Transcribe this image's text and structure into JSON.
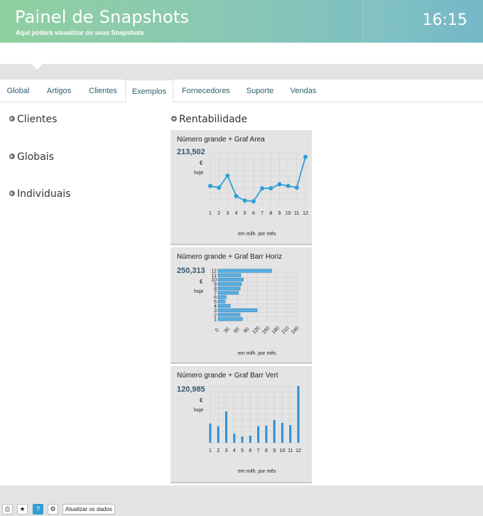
{
  "header": {
    "title": "Painel de Snapshots",
    "subtitle": "Aqui poderá visualizar os seus Snapshots",
    "time": "16:15"
  },
  "tabs": [
    "Global",
    "Artigos",
    "Clientes",
    "Exemplos",
    "Fornecedores",
    "Suporte",
    "Vendas"
  ],
  "active_tab": "Exemplos",
  "sections": [
    "Clientes",
    "Globais",
    "Individuais"
  ],
  "rentabilidade": "Rentabilidade",
  "cards": [
    {
      "title": "Número grande + Graf Area",
      "value": "213,502",
      "currency": "€",
      "period": "hoje",
      "units": "em milh. por mês"
    },
    {
      "title": "Número grande + Graf Barr Horiz",
      "value": "250,313",
      "currency": "€",
      "period": "hoje",
      "units": "em milh. por mês"
    },
    {
      "title": "Número grande + Graf Barr Vert",
      "value": "120,985",
      "currency": "€",
      "period": "hoje",
      "units": "em milh. por mês"
    }
  ],
  "footer": {
    "refresh_label": "Atualizar os dados",
    "icons": [
      "print-icon",
      "star-icon",
      "help-icon",
      "gear-icon"
    ]
  },
  "colors": {
    "accent": "#2f9fd6",
    "header_start": "#8fd0a0",
    "header_end": "#6fb6c6"
  },
  "chart_data": [
    {
      "type": "line",
      "x": [
        1,
        2,
        3,
        4,
        5,
        6,
        7,
        8,
        9,
        10,
        11,
        12
      ],
      "values": [
        55,
        50,
        85,
        25,
        12,
        10,
        48,
        48,
        60,
        55,
        50,
        140
      ],
      "ylim": [
        0,
        150
      ],
      "grid": true,
      "xlabel": "em milh. por mês"
    },
    {
      "type": "bar",
      "orientation": "horizontal",
      "categories": [
        "1",
        "2",
        "3",
        "4",
        "5",
        "6",
        "7",
        "8",
        "9",
        "10",
        "11",
        "12"
      ],
      "values": [
        75,
        68,
        120,
        38,
        22,
        25,
        63,
        68,
        72,
        78,
        70,
        165
      ],
      "xticks": [
        0,
        30,
        60,
        90,
        120,
        150,
        180,
        210,
        240
      ],
      "xlim": [
        0,
        240
      ],
      "grid": true,
      "xlabel": "em milh. por mês"
    },
    {
      "type": "bar",
      "orientation": "vertical",
      "categories": [
        "1",
        "2",
        "3",
        "4",
        "5",
        "6",
        "7",
        "8",
        "9",
        "10",
        "11",
        "12"
      ],
      "values": [
        68,
        58,
        110,
        32,
        22,
        25,
        58,
        60,
        80,
        70,
        62,
        200
      ],
      "ylim": [
        0,
        200
      ],
      "grid": true,
      "xlabel": "em milh. por mês"
    }
  ]
}
